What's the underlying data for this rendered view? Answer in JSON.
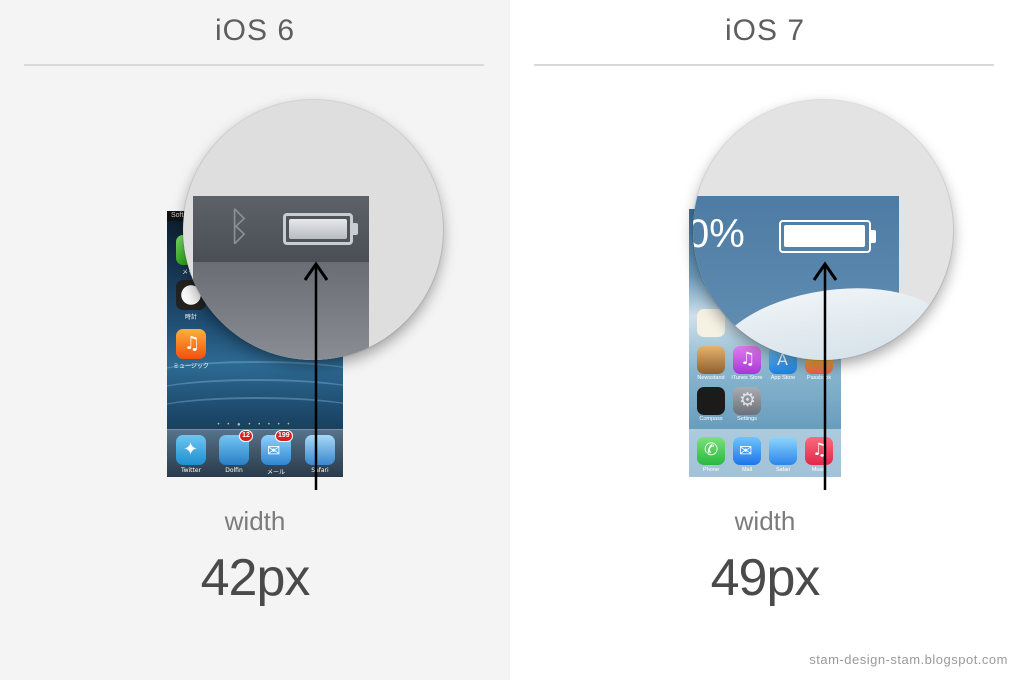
{
  "panels": {
    "left": {
      "title": "iOS 6",
      "caption_label": "width",
      "caption_value": "42px",
      "carrier": "Softb",
      "apps": [
        "メッセ",
        "時計",
        "ミュージック"
      ],
      "dock": [
        {
          "label": "Twitter",
          "badge": ""
        },
        {
          "label": "Dolfin",
          "badge": "12"
        },
        {
          "label": "メール",
          "badge": "199"
        },
        {
          "label": "Safari",
          "badge": ""
        }
      ]
    },
    "right": {
      "title": "iOS 7",
      "caption_label": "width",
      "caption_value": "49px",
      "battery_percent_fragment": "0%",
      "apps": [
        "Newsstand",
        "iTunes Store",
        "App Store",
        "Passbook",
        "Compass",
        "Settings"
      ],
      "dock": [
        "Phone",
        "Mail",
        "Safari",
        "Music"
      ]
    }
  },
  "footer": {
    "credit": "stam-design-stam.blogspot.com"
  },
  "icons": {
    "bluetooth": "bluetooth-icon",
    "battery": "battery-icon",
    "arrow": "arrow-up-icon"
  },
  "colors": {
    "left_bg": "#f4f4f4",
    "right_bg": "#ffffff",
    "title": "#5e5e5e",
    "caption": "#7b7b7b",
    "value": "#4a4a4a"
  }
}
